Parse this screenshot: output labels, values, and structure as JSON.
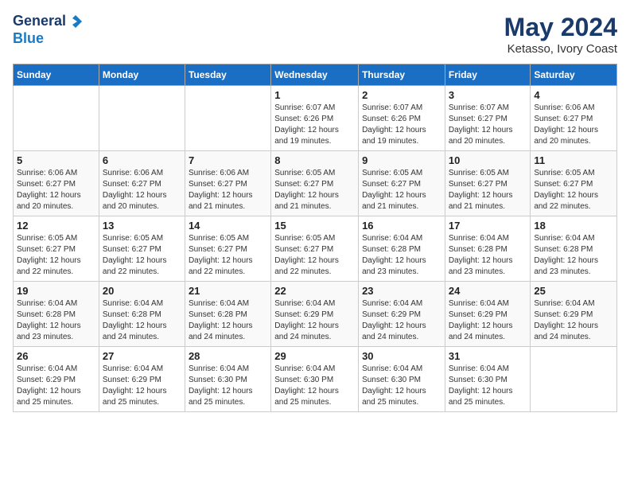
{
  "header": {
    "logo_general": "General",
    "logo_blue": "Blue",
    "month_year": "May 2024",
    "location": "Ketasso, Ivory Coast"
  },
  "days_of_week": [
    "Sunday",
    "Monday",
    "Tuesday",
    "Wednesday",
    "Thursday",
    "Friday",
    "Saturday"
  ],
  "weeks": [
    [
      {
        "day": "",
        "info": ""
      },
      {
        "day": "",
        "info": ""
      },
      {
        "day": "",
        "info": ""
      },
      {
        "day": "1",
        "info": "Sunrise: 6:07 AM\nSunset: 6:26 PM\nDaylight: 12 hours\nand 19 minutes."
      },
      {
        "day": "2",
        "info": "Sunrise: 6:07 AM\nSunset: 6:26 PM\nDaylight: 12 hours\nand 19 minutes."
      },
      {
        "day": "3",
        "info": "Sunrise: 6:07 AM\nSunset: 6:27 PM\nDaylight: 12 hours\nand 20 minutes."
      },
      {
        "day": "4",
        "info": "Sunrise: 6:06 AM\nSunset: 6:27 PM\nDaylight: 12 hours\nand 20 minutes."
      }
    ],
    [
      {
        "day": "5",
        "info": "Sunrise: 6:06 AM\nSunset: 6:27 PM\nDaylight: 12 hours\nand 20 minutes."
      },
      {
        "day": "6",
        "info": "Sunrise: 6:06 AM\nSunset: 6:27 PM\nDaylight: 12 hours\nand 20 minutes."
      },
      {
        "day": "7",
        "info": "Sunrise: 6:06 AM\nSunset: 6:27 PM\nDaylight: 12 hours\nand 21 minutes."
      },
      {
        "day": "8",
        "info": "Sunrise: 6:05 AM\nSunset: 6:27 PM\nDaylight: 12 hours\nand 21 minutes."
      },
      {
        "day": "9",
        "info": "Sunrise: 6:05 AM\nSunset: 6:27 PM\nDaylight: 12 hours\nand 21 minutes."
      },
      {
        "day": "10",
        "info": "Sunrise: 6:05 AM\nSunset: 6:27 PM\nDaylight: 12 hours\nand 21 minutes."
      },
      {
        "day": "11",
        "info": "Sunrise: 6:05 AM\nSunset: 6:27 PM\nDaylight: 12 hours\nand 22 minutes."
      }
    ],
    [
      {
        "day": "12",
        "info": "Sunrise: 6:05 AM\nSunset: 6:27 PM\nDaylight: 12 hours\nand 22 minutes."
      },
      {
        "day": "13",
        "info": "Sunrise: 6:05 AM\nSunset: 6:27 PM\nDaylight: 12 hours\nand 22 minutes."
      },
      {
        "day": "14",
        "info": "Sunrise: 6:05 AM\nSunset: 6:27 PM\nDaylight: 12 hours\nand 22 minutes."
      },
      {
        "day": "15",
        "info": "Sunrise: 6:05 AM\nSunset: 6:27 PM\nDaylight: 12 hours\nand 22 minutes."
      },
      {
        "day": "16",
        "info": "Sunrise: 6:04 AM\nSunset: 6:28 PM\nDaylight: 12 hours\nand 23 minutes."
      },
      {
        "day": "17",
        "info": "Sunrise: 6:04 AM\nSunset: 6:28 PM\nDaylight: 12 hours\nand 23 minutes."
      },
      {
        "day": "18",
        "info": "Sunrise: 6:04 AM\nSunset: 6:28 PM\nDaylight: 12 hours\nand 23 minutes."
      }
    ],
    [
      {
        "day": "19",
        "info": "Sunrise: 6:04 AM\nSunset: 6:28 PM\nDaylight: 12 hours\nand 23 minutes."
      },
      {
        "day": "20",
        "info": "Sunrise: 6:04 AM\nSunset: 6:28 PM\nDaylight: 12 hours\nand 24 minutes."
      },
      {
        "day": "21",
        "info": "Sunrise: 6:04 AM\nSunset: 6:28 PM\nDaylight: 12 hours\nand 24 minutes."
      },
      {
        "day": "22",
        "info": "Sunrise: 6:04 AM\nSunset: 6:29 PM\nDaylight: 12 hours\nand 24 minutes."
      },
      {
        "day": "23",
        "info": "Sunrise: 6:04 AM\nSunset: 6:29 PM\nDaylight: 12 hours\nand 24 minutes."
      },
      {
        "day": "24",
        "info": "Sunrise: 6:04 AM\nSunset: 6:29 PM\nDaylight: 12 hours\nand 24 minutes."
      },
      {
        "day": "25",
        "info": "Sunrise: 6:04 AM\nSunset: 6:29 PM\nDaylight: 12 hours\nand 24 minutes."
      }
    ],
    [
      {
        "day": "26",
        "info": "Sunrise: 6:04 AM\nSunset: 6:29 PM\nDaylight: 12 hours\nand 25 minutes."
      },
      {
        "day": "27",
        "info": "Sunrise: 6:04 AM\nSunset: 6:29 PM\nDaylight: 12 hours\nand 25 minutes."
      },
      {
        "day": "28",
        "info": "Sunrise: 6:04 AM\nSunset: 6:30 PM\nDaylight: 12 hours\nand 25 minutes."
      },
      {
        "day": "29",
        "info": "Sunrise: 6:04 AM\nSunset: 6:30 PM\nDaylight: 12 hours\nand 25 minutes."
      },
      {
        "day": "30",
        "info": "Sunrise: 6:04 AM\nSunset: 6:30 PM\nDaylight: 12 hours\nand 25 minutes."
      },
      {
        "day": "31",
        "info": "Sunrise: 6:04 AM\nSunset: 6:30 PM\nDaylight: 12 hours\nand 25 minutes."
      },
      {
        "day": "",
        "info": ""
      }
    ]
  ]
}
